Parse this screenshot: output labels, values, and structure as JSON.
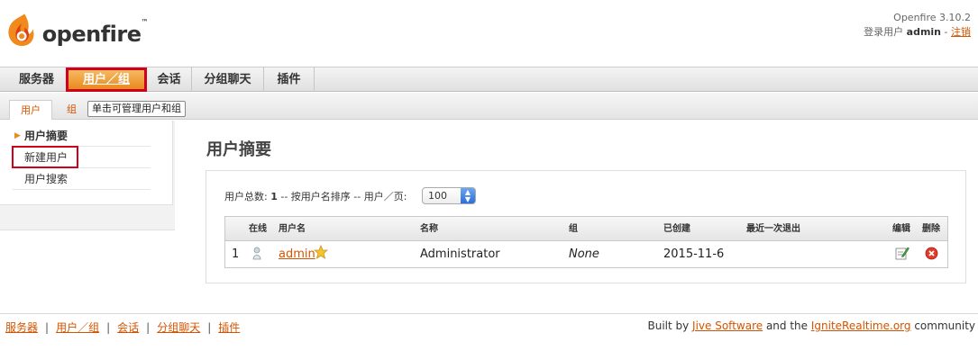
{
  "header": {
    "brand": "openfire",
    "version": "Openfire 3.10.2",
    "login_prefix": "登录用户",
    "user": "admin",
    "dash": "-",
    "logout": "注销"
  },
  "main_tabs": [
    {
      "label": "服务器"
    },
    {
      "label": "用户／组"
    },
    {
      "label": "会话"
    },
    {
      "label": "分组聊天"
    },
    {
      "label": "插件"
    }
  ],
  "sub_tabs": [
    {
      "label": "用户"
    },
    {
      "label": "组"
    }
  ],
  "tooltip": "单击可管理用户和组",
  "sidebar": {
    "items": [
      {
        "label": "用户摘要"
      },
      {
        "label": "新建用户"
      },
      {
        "label": "用户搜索"
      }
    ]
  },
  "content": {
    "title": "用户摘要",
    "summary_prefix": "用户总数: ",
    "total": "1",
    "summary_middle": " -- 按用户名排序 -- 用户／页: ",
    "per_page": "100"
  },
  "table": {
    "columns": [
      "在线",
      "用户名",
      "名称",
      "组",
      "已创建",
      "最近一次退出",
      "编辑",
      "删除"
    ],
    "rows": [
      {
        "index": "1",
        "username": "admin",
        "name": "Administrator",
        "group": "None",
        "created": "2015-11-6",
        "last_logout": ""
      }
    ]
  },
  "footer": {
    "links": [
      "服务器",
      "用户／组",
      "会话",
      "分组聊天",
      "插件"
    ],
    "built_by": "Built by ",
    "jive": "Jive Software",
    "and_the": " and the ",
    "ignite": "IgniteRealtime.org",
    "community": " community"
  },
  "colors": {
    "accent": "#e88b1f",
    "link": "#d35400",
    "highlight_box": "#d0021b"
  }
}
